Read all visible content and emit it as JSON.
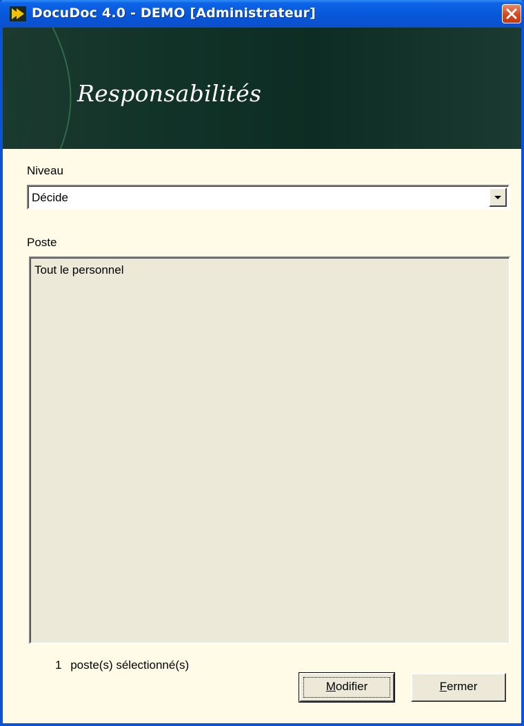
{
  "window": {
    "title": "DocuDoc 4.0 - DEMO [Administrateur]",
    "accent": "#0a52d6"
  },
  "banner": {
    "title": "Responsabilités"
  },
  "form": {
    "niveau_label": "Niveau",
    "niveau_value": "Décide",
    "poste_label": "Poste",
    "poste_items": [
      "Tout le personnel"
    ],
    "selected_count": "1",
    "selected_label": "poste(s) sélectionné(s)"
  },
  "buttons": {
    "modifier_prefix": "M",
    "modifier_rest": "odifier",
    "fermer_prefix": "F",
    "fermer_rest": "ermer"
  },
  "icons": {
    "app": "docudoc-logo-icon",
    "close": "close-icon",
    "dropdown": "chevron-down-icon"
  }
}
